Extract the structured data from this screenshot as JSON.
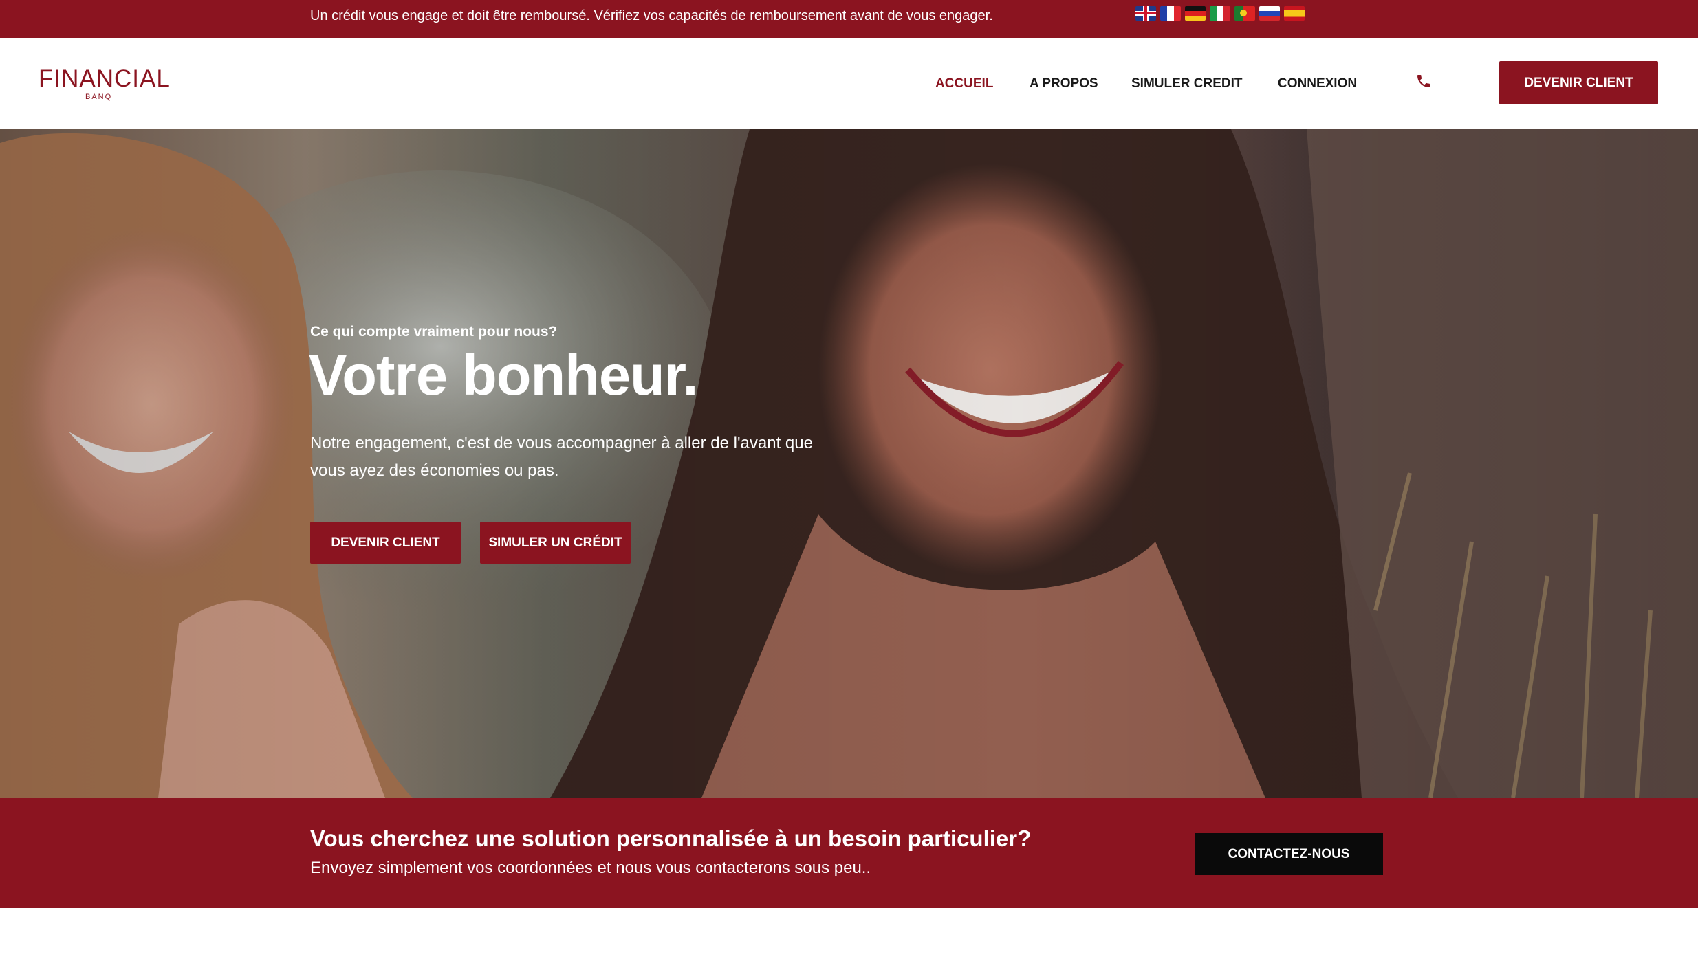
{
  "topbar": {
    "notice": "Un crédit vous engage et doit être remboursé. Vérifiez vos capacités de remboursement avant de vous engager.",
    "languages": [
      "uk-flag-icon",
      "france-flag-icon",
      "germany-flag-icon",
      "italy-flag-icon",
      "portugal-flag-icon",
      "russia-flag-icon",
      "spain-flag-icon"
    ]
  },
  "header": {
    "logo_main": "FINANCIAL",
    "logo_sub": "BANQ",
    "nav": {
      "home": "ACCUEIL",
      "about": "A PROPOS",
      "simulate": "SIMULER CREDIT",
      "login": "CONNEXION"
    },
    "phone_icon": "phone-icon",
    "cta": "DEVENIR CLIENT"
  },
  "hero": {
    "eyebrow": "Ce qui compte vraiment pour nous?",
    "headline": "Votre bonheur.",
    "text": "Notre engagement, c'est de vous accompagner à aller de l'avant que vous ayez des économies ou pas.",
    "btn_client": "DEVENIR CLIENT",
    "btn_simulate": "SIMULER UN CRÉDIT"
  },
  "band": {
    "title": "Vous cherchez une solution personnalisée à un besoin particulier?",
    "subtitle": "Envoyez simplement vos coordonnées et nous vous contacterons sous peu..",
    "button": "CONTACTEZ-NOUS"
  },
  "colors": {
    "brand": "#8b1420",
    "dark": "#0a0a0a",
    "white": "#ffffff"
  }
}
